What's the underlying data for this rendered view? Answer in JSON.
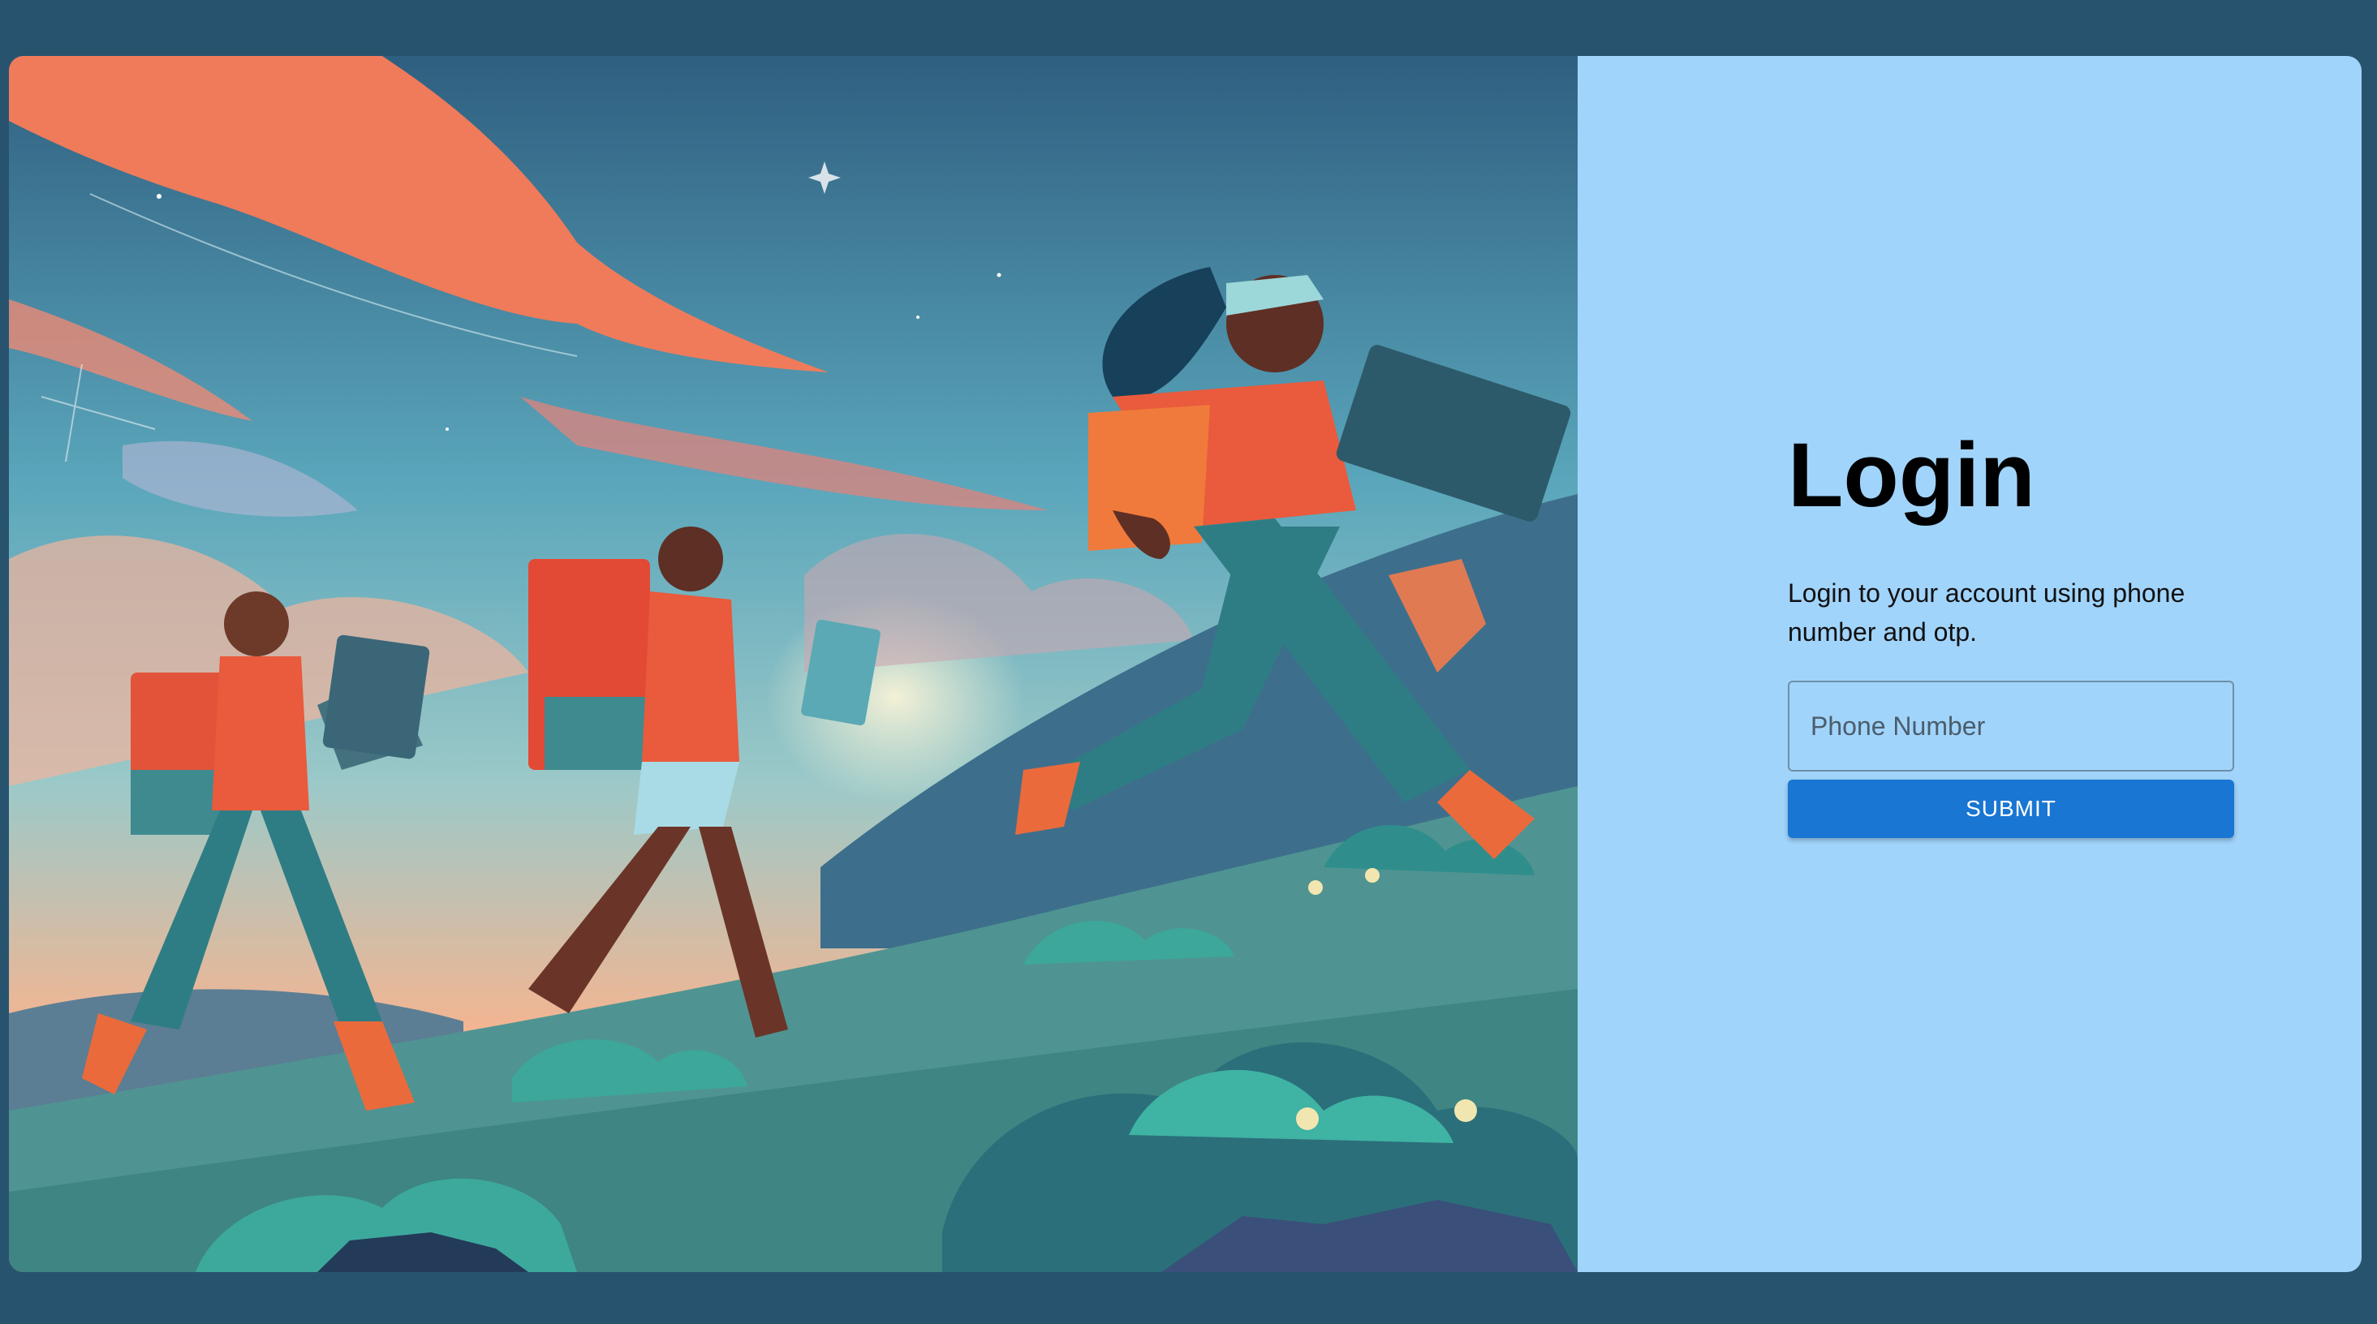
{
  "hero": {
    "image_name": "people-running-with-laptops-illustration",
    "colors": {
      "sky_top": "#2f6a86",
      "sky_mid": "#6fb6c4",
      "sky_horizon": "#f2a27a",
      "cloud": "#f0775a",
      "hill": "#4d8f8f",
      "hill_dark": "#2d6a78",
      "shirt": "#ea5a3c",
      "pants": "#2f7d84",
      "skin": "#7a3f2f"
    }
  },
  "login": {
    "title": "Login",
    "subtitle": "Login to your account using phone number and otp.",
    "phone_placeholder": "Phone Number",
    "submit_label": "SUBMIT"
  },
  "colors": {
    "page_background": "#28536e",
    "panel_background": "#a1d4fb",
    "button": "#1976d2"
  }
}
